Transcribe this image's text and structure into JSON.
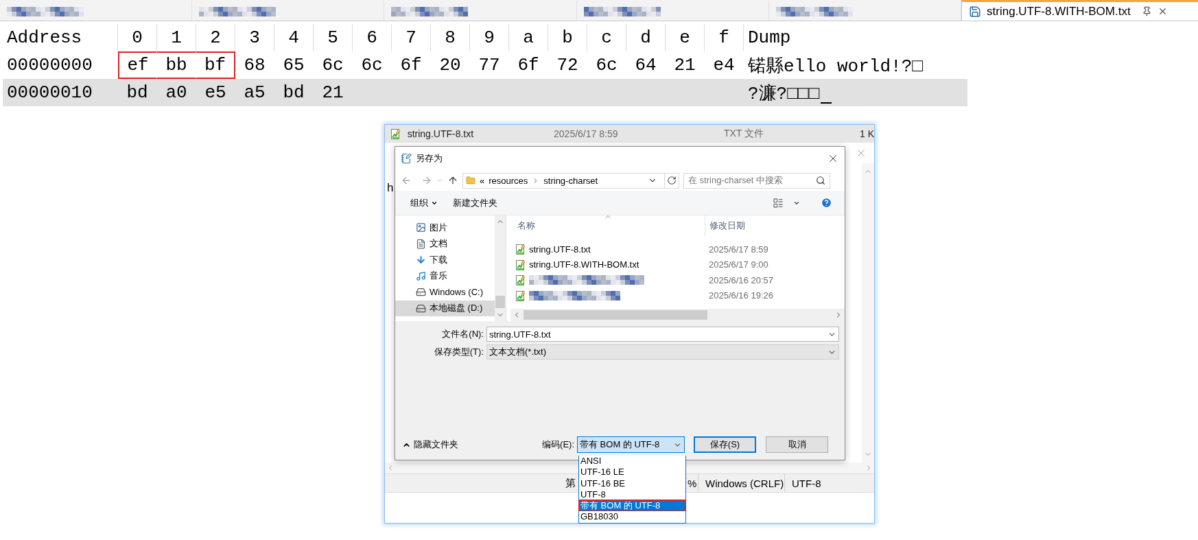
{
  "tabs": [
    {
      "kind": "redacted",
      "selected": false
    },
    {
      "kind": "redacted",
      "selected": false
    },
    {
      "kind": "redacted",
      "selected": false
    },
    {
      "kind": "redacted",
      "selected": false
    },
    {
      "kind": "redacted",
      "selected": false
    },
    {
      "kind": "file",
      "label": "string.UTF-8.WITH-BOM.txt",
      "selected": true
    }
  ],
  "hex": {
    "address_header": "Address",
    "byte_headers": [
      "0",
      "1",
      "2",
      "3",
      "4",
      "5",
      "6",
      "7",
      "8",
      "9",
      "a",
      "b",
      "c",
      "d",
      "e",
      "f"
    ],
    "dump_header": "Dump",
    "rows": [
      {
        "address": "00000000",
        "current": false,
        "cursor": false,
        "dump": "锘縣ello world!?□",
        "bytes": [
          {
            "v": "ef",
            "boxed": true
          },
          {
            "v": "bb",
            "boxed": true
          },
          {
            "v": "bf",
            "boxed": true
          },
          {
            "v": "68",
            "boxed": false
          },
          {
            "v": "65",
            "boxed": false
          },
          {
            "v": "6c",
            "boxed": false
          },
          {
            "v": "6c",
            "boxed": false
          },
          {
            "v": "6f",
            "boxed": false
          },
          {
            "v": "20",
            "boxed": false
          },
          {
            "v": "77",
            "boxed": false
          },
          {
            "v": "6f",
            "boxed": false
          },
          {
            "v": "72",
            "boxed": false
          },
          {
            "v": "6c",
            "boxed": false
          },
          {
            "v": "64",
            "boxed": false
          },
          {
            "v": "21",
            "boxed": false
          },
          {
            "v": "e4",
            "boxed": false
          }
        ]
      },
      {
        "address": "00000010",
        "current": true,
        "cursor": true,
        "dump": "?濂?□□□",
        "bytes": [
          {
            "v": "bd",
            "boxed": false
          },
          {
            "v": "a0",
            "boxed": false
          },
          {
            "v": "e5",
            "boxed": false
          },
          {
            "v": "a5",
            "boxed": false
          },
          {
            "v": "bd",
            "boxed": false
          },
          {
            "v": "21",
            "boxed": false
          }
        ]
      }
    ]
  },
  "background_window": {
    "file_row": {
      "name": "string.UTF-8.txt",
      "date": "2025/6/17 8:59",
      "type": "TXT 文件",
      "size": "1 K"
    },
    "content_fragment": "h",
    "status_bar": [
      "第",
      "%",
      "Windows (CRLF)",
      "UTF-8"
    ]
  },
  "save_dialog": {
    "title": "另存为",
    "path_prefix": "«",
    "path": [
      "resources",
      "string-charset"
    ],
    "search": {
      "placeholder": "在 string-charset 中搜索"
    },
    "toolbar": {
      "organize": "组织",
      "new_folder": "新建文件夹"
    },
    "nav": [
      {
        "kind": "pictures",
        "label": "图片",
        "selected": false
      },
      {
        "kind": "documents",
        "label": "文档",
        "selected": false
      },
      {
        "kind": "downloads",
        "label": "下载",
        "selected": false
      },
      {
        "kind": "music",
        "label": "音乐",
        "selected": false
      },
      {
        "kind": "drive",
        "label": "Windows (C:)",
        "selected": false
      },
      {
        "kind": "drive",
        "label": "本地磁盘 (D:)",
        "selected": true
      }
    ],
    "list_columns": [
      "名称",
      "修改日期"
    ],
    "files": [
      {
        "kind": "file",
        "name": "string.UTF-8.txt",
        "date": "2025/6/17 8:59"
      },
      {
        "kind": "file",
        "name": "string.UTF-8.WITH-BOM.txt",
        "date": "2025/6/17 9:00"
      },
      {
        "kind": "redacted",
        "date": "2025/6/16 20:57"
      },
      {
        "kind": "redacted",
        "date": "2025/6/16 19:26"
      }
    ],
    "file_name": {
      "label": "文件名(N):",
      "value": "string.UTF-8.txt"
    },
    "file_type": {
      "label": "保存类型(T):",
      "value": "文本文档(*.txt)"
    },
    "hide_folders": "隐藏文件夹",
    "encoding": {
      "label": "编码(E):",
      "value": "带有 BOM 的 UTF-8",
      "expanded": true,
      "options": [
        {
          "label": "ANSI",
          "selected": false,
          "boxed": false
        },
        {
          "label": "UTF-16 LE",
          "selected": false,
          "boxed": false
        },
        {
          "label": "UTF-16 BE",
          "selected": false,
          "boxed": false
        },
        {
          "label": "UTF-8",
          "selected": false,
          "boxed": false
        },
        {
          "label": "带有 BOM 的 UTF-8",
          "selected": true,
          "boxed": true
        },
        {
          "label": "GB18030",
          "selected": false,
          "boxed": false
        }
      ]
    },
    "buttons": [
      {
        "kind": "primary",
        "label": "保存(S)"
      },
      {
        "kind": "secondary",
        "label": "取消"
      }
    ]
  }
}
